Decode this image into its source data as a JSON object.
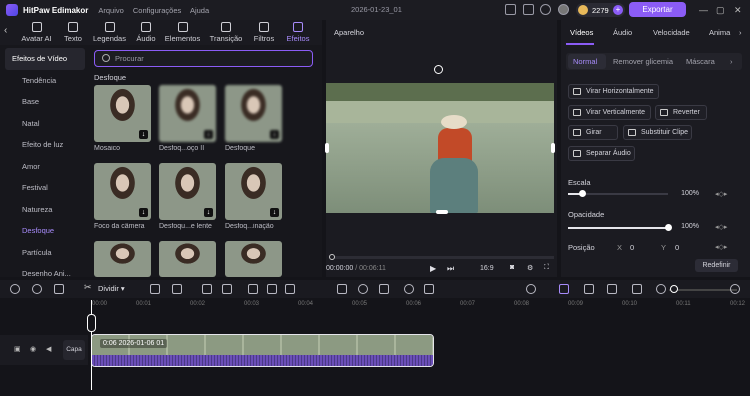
{
  "app": {
    "name": "HitPaw Edimakor",
    "menu": [
      "Arquivo",
      "Configurações",
      "Ajuda"
    ],
    "project": "2026-01-23_01",
    "credits": "2279",
    "export_label": "Exportar"
  },
  "left_tabs": [
    {
      "label": "Avatar AI",
      "icon": "avatar-icon"
    },
    {
      "label": "Texto",
      "icon": "text-icon"
    },
    {
      "label": "Legendas",
      "icon": "captions-icon"
    },
    {
      "label": "Áudio",
      "icon": "music-icon"
    },
    {
      "label": "Elementos",
      "icon": "elements-icon"
    },
    {
      "label": "Transição",
      "icon": "transition-icon"
    },
    {
      "label": "Filtros",
      "icon": "filter-icon"
    },
    {
      "label": "Efeitos",
      "icon": "effects-icon"
    }
  ],
  "categories": [
    "Efeitos de Vídeo",
    "Tendência",
    "Base",
    "Natal",
    "Efeito de luz",
    "Amor",
    "Festival",
    "Natureza",
    "Desfoque",
    "Partícula",
    "Desenho Ani..."
  ],
  "search": {
    "placeholder": "Procurar"
  },
  "group_title": "Desfoque",
  "effects": [
    {
      "label": "Mosaico"
    },
    {
      "label": "Desfoq...oço II"
    },
    {
      "label": "Desfoque"
    },
    {
      "label": "Foco da câmera"
    },
    {
      "label": "Desfoqu...e lente"
    },
    {
      "label": "Desfoq...inação"
    },
    {
      "label": ""
    },
    {
      "label": ""
    },
    {
      "label": ""
    }
  ],
  "preview": {
    "title": "Aparelho",
    "current_time": "00:00:00",
    "total_time": "00:06:11",
    "ratio": "16:9"
  },
  "right_tabs": [
    "Vídeos",
    "Áudio",
    "Velocidade",
    "Anima"
  ],
  "sub_tabs": [
    "Normal",
    "Remover glicemia",
    "Máscara"
  ],
  "actions": {
    "flip_h": "Virar Horizontalmente",
    "flip_v": "Virar Verticalmente",
    "reverse": "Reverter",
    "rotate": "Girar",
    "replace": "Substituir Clipe",
    "separate_audio": "Separar Áudio"
  },
  "props": {
    "scale_label": "Escala",
    "scale_value": "100%",
    "scale_level": 0.14,
    "opacity_label": "Opacidade",
    "opacity_value": "100%",
    "opacity_level": 1.0,
    "position_label": "Posição",
    "x_label": "X",
    "x_value": "0",
    "y_label": "Y",
    "y_value": "0"
  },
  "reset_label": "Redefinir",
  "toolbar": {
    "split_label": "Dividir"
  },
  "ruler": [
    "00:00",
    "00:01",
    "00:02",
    "00:03",
    "00:04",
    "00:05",
    "00:06",
    "00:07",
    "00:08",
    "00:09",
    "00:10",
    "00:11",
    "00:12"
  ],
  "track": {
    "layer_label": "Capa",
    "clip_label": "0:06 2026-01-06 01"
  }
}
